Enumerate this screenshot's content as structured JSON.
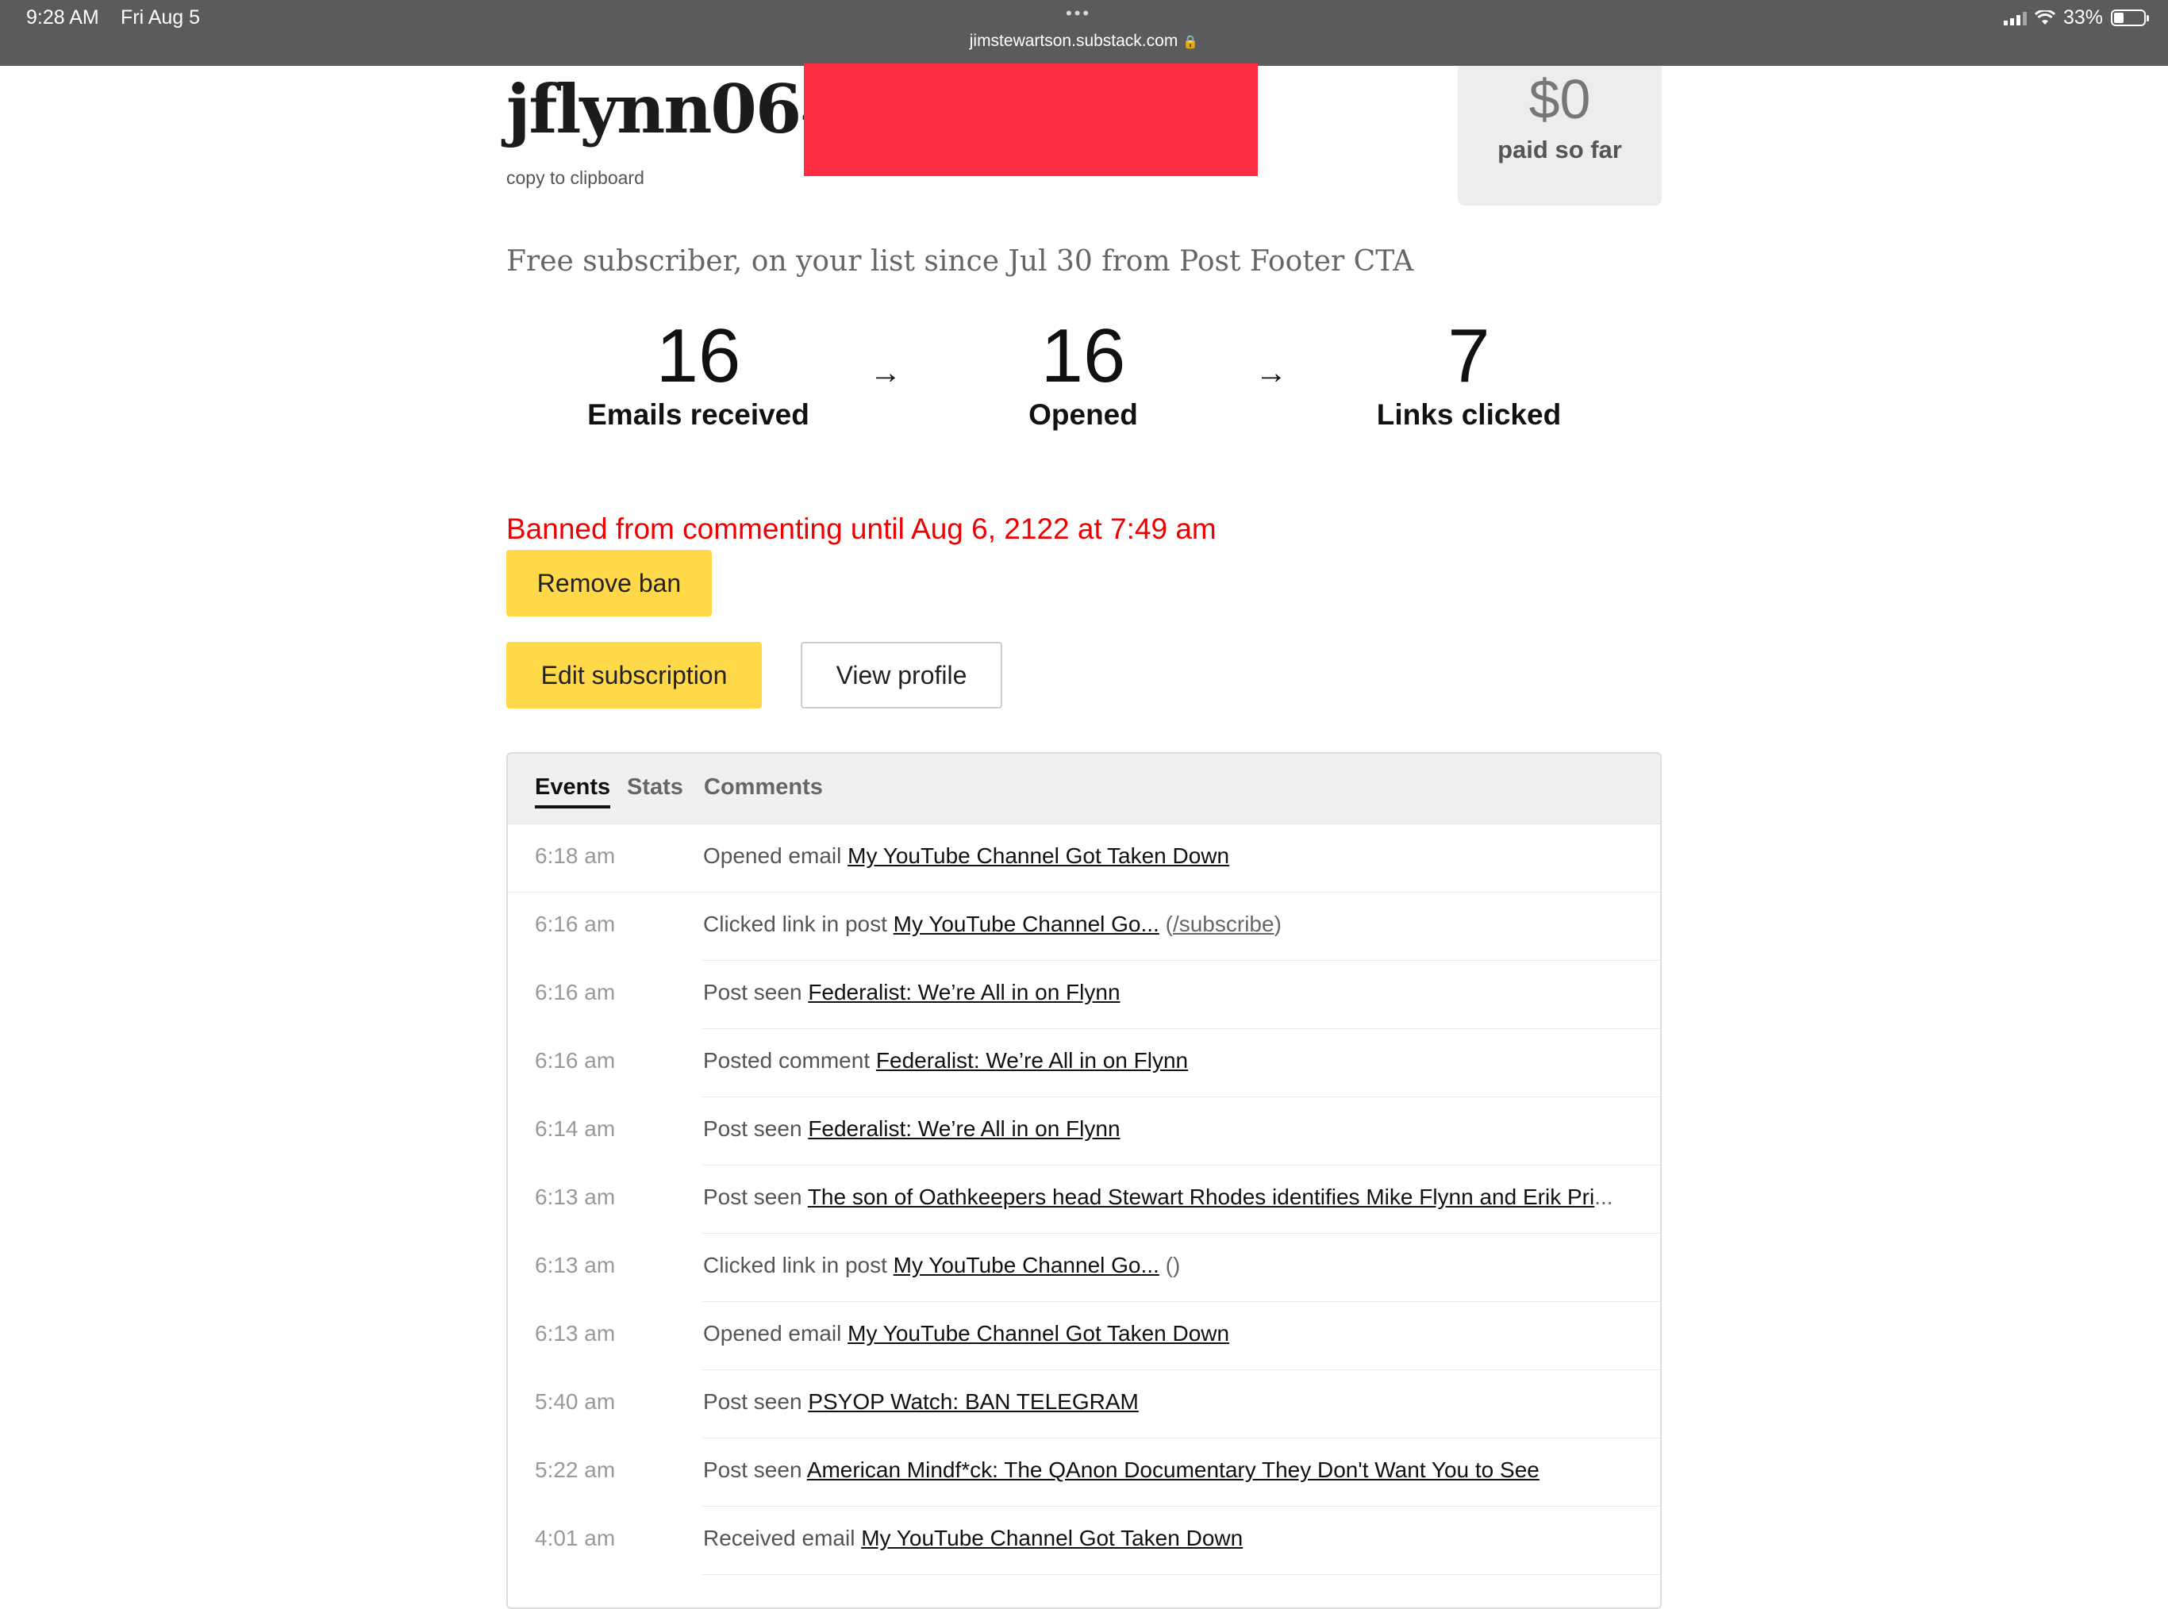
{
  "status_bar": {
    "time": "9:28 AM",
    "date": "Fri Aug 5",
    "dots": "•••",
    "url": "jimstewartson.substack.com",
    "lock_icon": "lock-icon",
    "battery": "33%"
  },
  "header": {
    "username": "jflynn064(",
    "copy_label": "copy to clipboard",
    "paid_amount": "$0",
    "paid_label": "paid so far",
    "redaction_color": "#fe2d42"
  },
  "subscriber_line": "Free subscriber, on your list since Jul 30 from Post Footer CTA",
  "funnel": {
    "arrow": "→",
    "stats": [
      {
        "value": "16",
        "label": "Emails received"
      },
      {
        "value": "16",
        "label": "Opened"
      },
      {
        "value": "7",
        "label": "Links clicked"
      }
    ]
  },
  "ban_message": "Banned from commenting until Aug 6, 2122 at 7:49 am",
  "buttons": {
    "remove_ban": "Remove ban",
    "edit_subscription": "Edit subscription",
    "view_profile": "View profile",
    "accent_color": "#ffd94a"
  },
  "tabs": [
    "Events",
    "Stats",
    "Comments"
  ],
  "events": [
    {
      "time": "6:18 am",
      "action": "Opened email",
      "link": "My YouTube Channel Got Taken Down",
      "extra": ""
    },
    {
      "time": "6:16 am",
      "action": "Clicked link in post",
      "link": "My YouTube Channel Go...",
      "extra_pre": "(",
      "extra_link": "/subscribe",
      "extra_post": ")"
    },
    {
      "time": "6:16 am",
      "action": "Post seen",
      "link": "Federalist: We’re All in on Flynn",
      "extra": ""
    },
    {
      "time": "6:16 am",
      "action": "Posted comment",
      "link": "Federalist: We’re All in on Flynn",
      "extra": ""
    },
    {
      "time": "6:14 am",
      "action": "Post seen",
      "link": "Federalist: We’re All in on Flynn",
      "extra": ""
    },
    {
      "time": "6:13 am",
      "action": "Post seen",
      "link": "The son of Oathkeepers head Stewart Rhodes identifies Mike Flynn and Erik Pri",
      "extra": "..."
    },
    {
      "time": "6:13 am",
      "action": "Clicked link in post",
      "link": "My YouTube Channel Go...",
      "extra": "()"
    },
    {
      "time": "6:13 am",
      "action": "Opened email",
      "link": "My YouTube Channel Got Taken Down",
      "extra": ""
    },
    {
      "time": "5:40 am",
      "action": "Post seen",
      "link": "PSYOP Watch: BAN TELEGRAM",
      "extra": ""
    },
    {
      "time": "5:22 am",
      "action": "Post seen",
      "link": "American Mindf*ck: The QAnon Documentary They Don't Want You to See",
      "extra": ""
    },
    {
      "time": "4:01 am",
      "action": "Received email",
      "link": "My YouTube Channel Got Taken Down",
      "extra": ""
    }
  ]
}
